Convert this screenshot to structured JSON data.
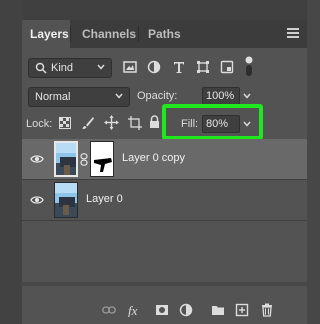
{
  "tabs": [
    {
      "label": "Layers",
      "active": true
    },
    {
      "label": "Channels",
      "active": false
    },
    {
      "label": "Paths",
      "active": false
    }
  ],
  "filter": {
    "kind_label": "Kind"
  },
  "blend": {
    "mode": "Normal",
    "opacity_label": "Opacity:",
    "opacity_value": "100%"
  },
  "lock": {
    "label": "Lock:",
    "fill_label": "Fill:",
    "fill_value": "80%"
  },
  "layers": [
    {
      "name": "Layer 0 copy",
      "selected": true,
      "has_mask": true
    },
    {
      "name": "Layer 0",
      "selected": false,
      "has_mask": false
    }
  ],
  "colors": {
    "highlight": "#20e81f",
    "panel": "#535353",
    "selected_row": "#696969"
  },
  "icons": [
    "eye-icon",
    "link-icon",
    "fx-icon",
    "add-mask-icon",
    "adjustment-icon",
    "folder-icon",
    "new-layer-icon",
    "trash-icon"
  ]
}
